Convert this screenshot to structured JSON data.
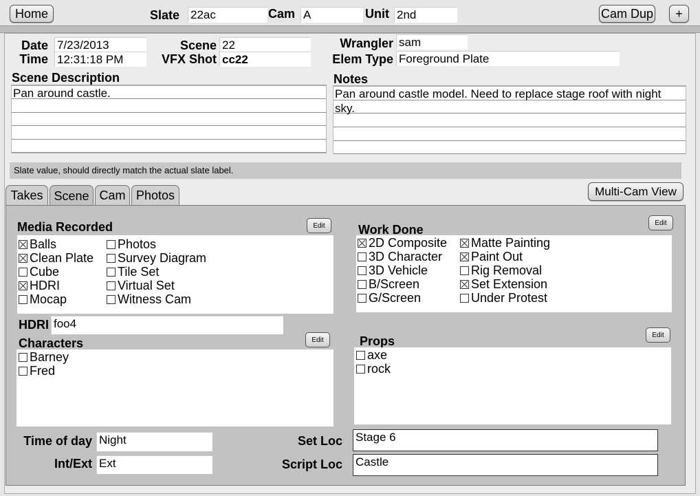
{
  "topbar": {
    "home_label": "Home",
    "slate_label": "Slate",
    "slate_value": "22ac",
    "cam_label": "Cam",
    "cam_value": "A",
    "unit_label": "Unit",
    "unit_value": "2nd",
    "cam_dup_label": "Cam Dup",
    "plus_label": "+"
  },
  "header": {
    "date_label": "Date",
    "date_value": "7/23/2013",
    "time_label": "Time",
    "time_value": "12:31:18 PM",
    "scene_label": "Scene",
    "scene_value": "22",
    "vfx_label": "VFX Shot",
    "vfx_value": "cc22",
    "wrangler_label": "Wrangler",
    "wrangler_value": "sam",
    "elem_label": "Elem Type",
    "elem_value": "Foreground Plate"
  },
  "scene_description": {
    "label": "Scene Description",
    "text": "Pan around castle."
  },
  "notes": {
    "label": "Notes",
    "text": "Pan around castle model. Need to replace stage roof with night sky."
  },
  "status_text": "Slate value, should directly match the actual slate label.",
  "tabs": [
    {
      "label": "Takes"
    },
    {
      "label": "Scene"
    },
    {
      "label": "Cam"
    },
    {
      "label": "Photos"
    }
  ],
  "multicam_label": "Multi-Cam View",
  "edit_label": "Edit",
  "media_recorded": {
    "label": "Media Recorded",
    "col1": [
      {
        "label": "Balls",
        "checked": true
      },
      {
        "label": "Clean Plate",
        "checked": true
      },
      {
        "label": "Cube",
        "checked": false
      },
      {
        "label": "HDRI",
        "checked": true
      },
      {
        "label": "Mocap",
        "checked": false
      }
    ],
    "col2": [
      {
        "label": "Photos",
        "checked": false
      },
      {
        "label": "Survey Diagram",
        "checked": false
      },
      {
        "label": "Tile Set",
        "checked": false
      },
      {
        "label": "Virtual Set",
        "checked": false
      },
      {
        "label": "Witness Cam",
        "checked": false
      }
    ]
  },
  "work_done": {
    "label": "Work Done",
    "col1": [
      {
        "label": "2D Composite",
        "checked": true
      },
      {
        "label": "3D Character",
        "checked": false
      },
      {
        "label": "3D Vehicle",
        "checked": false
      },
      {
        "label": "B/Screen",
        "checked": false
      },
      {
        "label": "G/Screen",
        "checked": false
      }
    ],
    "col2": [
      {
        "label": "Matte Painting",
        "checked": true
      },
      {
        "label": "Paint Out",
        "checked": true
      },
      {
        "label": "Rig Removal",
        "checked": false
      },
      {
        "label": "Set Extension",
        "checked": true
      },
      {
        "label": "Under Protest",
        "checked": false
      }
    ]
  },
  "hdri": {
    "label": "HDRI",
    "value": "foo4"
  },
  "characters": {
    "label": "Characters",
    "items": [
      {
        "label": "Barney",
        "checked": false
      },
      {
        "label": "Fred",
        "checked": false
      }
    ]
  },
  "props": {
    "label": "Props",
    "items": [
      {
        "label": "axe",
        "checked": false
      },
      {
        "label": "rock",
        "checked": false
      }
    ]
  },
  "bottom": {
    "time_of_day_label": "Time of day",
    "time_of_day_value": "Night",
    "int_ext_label": "Int/Ext",
    "int_ext_value": "Ext",
    "set_loc_label": "Set Loc",
    "set_loc_value": "Stage 6",
    "script_loc_label": "Script Loc",
    "script_loc_value": "Castle"
  }
}
